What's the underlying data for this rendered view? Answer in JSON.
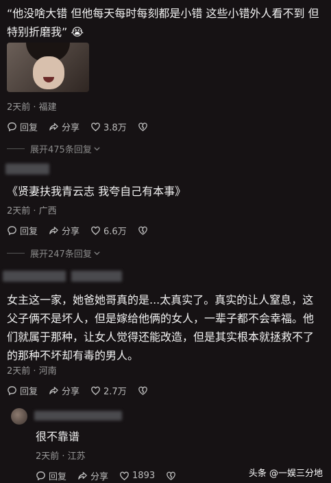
{
  "comments": [
    {
      "text": "“他没啥大错 但他每天每时每刻都是小错 这些小错外人看不到 但特别折磨我” 😭",
      "meta": "2天前 · 福建",
      "reply_label": "回复",
      "share_label": "分享",
      "likes": "3.8万",
      "expand_label": "展开475条回复"
    },
    {
      "text": "《贤妻扶我青云志  我夸自己有本事》",
      "meta": "2天前 · 广西",
      "reply_label": "回复",
      "share_label": "分享",
      "likes": "6.6万",
      "expand_label": "展开247条回复"
    },
    {
      "text": "女主这一家，她爸她哥真的是...太真实了。真实的让人窒息，这父子俩不是坏人，但是嫁给他俩的女人，一辈子都不会幸福。他们就属于那种，让女人觉得还能改造，但是其实根本就拯救不了的那种不坏却有毒的男人。",
      "meta": "2天前 · 河南",
      "reply_label": "回复",
      "share_label": "分享",
      "likes": "2.7万"
    },
    {
      "text": "很不靠谱",
      "meta": "2天前 · 江苏",
      "reply_label": "回复",
      "share_label": "分享",
      "likes": "1893"
    }
  ],
  "watermark": "头条 @一娱三分地"
}
